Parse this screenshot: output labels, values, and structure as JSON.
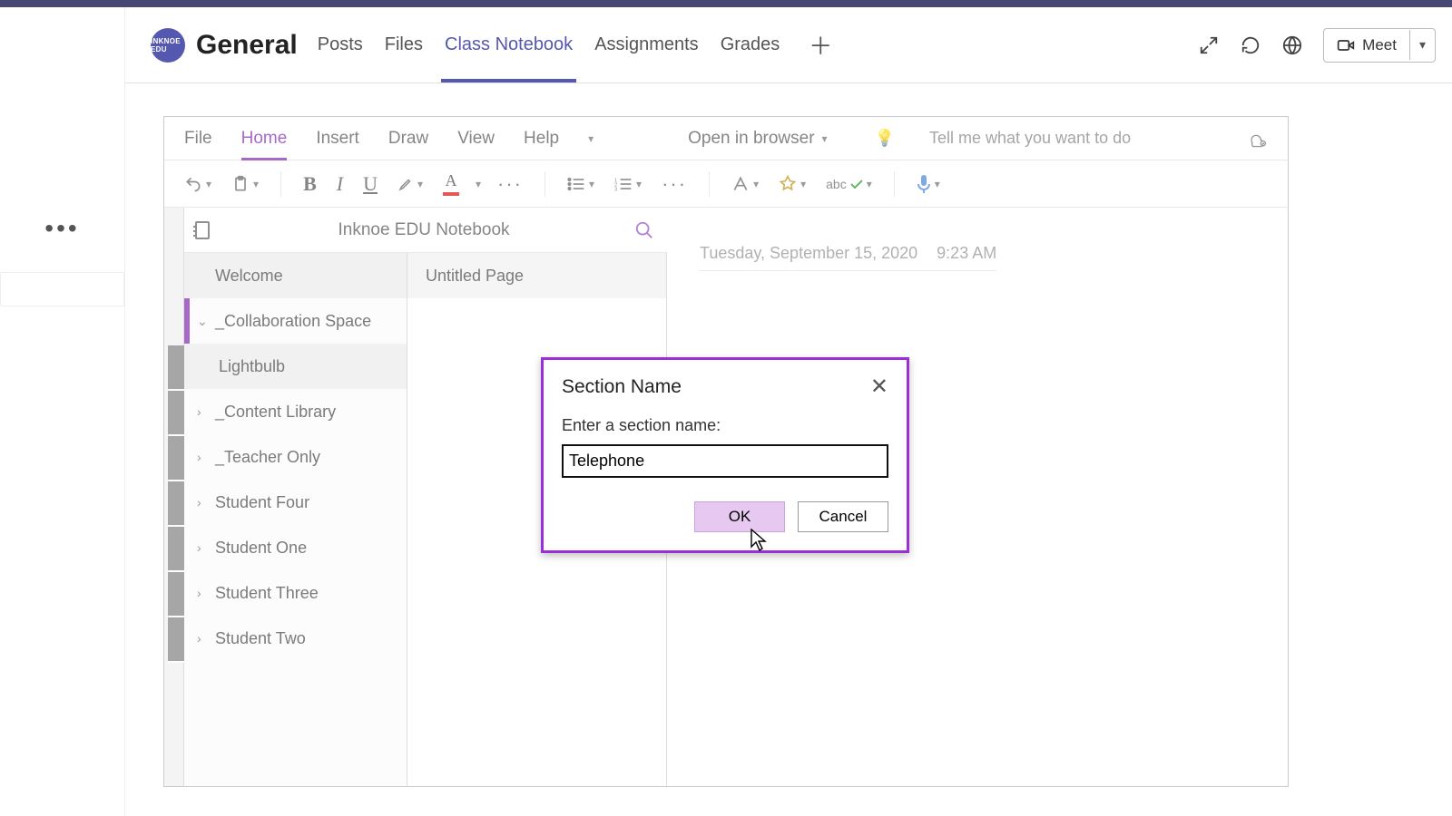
{
  "team": {
    "avatar_text": "INKNOE EDU",
    "channel": "General"
  },
  "tabs": {
    "items": [
      "Posts",
      "Files",
      "Class Notebook",
      "Assignments",
      "Grades"
    ],
    "active_index": 2
  },
  "header_actions": {
    "meet_label": "Meet"
  },
  "onenote": {
    "ribbon_tabs": [
      "File",
      "Home",
      "Insert",
      "Draw",
      "View",
      "Help"
    ],
    "ribbon_active_index": 1,
    "open_in_browser": "Open in browser",
    "tell_me_placeholder": "Tell me what you want to do",
    "notebook_title": "Inknoe EDU Notebook",
    "sections": [
      {
        "label": "Welcome",
        "expandable": false,
        "selected": true,
        "children": []
      },
      {
        "label": "_Collaboration Space",
        "expandable": true,
        "expanded": true,
        "children": [
          {
            "label": "Lightbulb",
            "selected": true
          }
        ]
      },
      {
        "label": "_Content Library",
        "expandable": true
      },
      {
        "label": "_Teacher Only",
        "expandable": true
      },
      {
        "label": "Student Four",
        "expandable": true
      },
      {
        "label": "Student One",
        "expandable": true
      },
      {
        "label": "Student Three",
        "expandable": true
      },
      {
        "label": "Student Two",
        "expandable": true
      }
    ],
    "pages": [
      {
        "label": "Untitled Page",
        "selected": true
      }
    ],
    "page_date": "Tuesday, September 15, 2020",
    "page_time": "9:23 AM"
  },
  "dialog": {
    "title": "Section Name",
    "prompt": "Enter a section name:",
    "value": "Telephone",
    "ok": "OK",
    "cancel": "Cancel"
  }
}
